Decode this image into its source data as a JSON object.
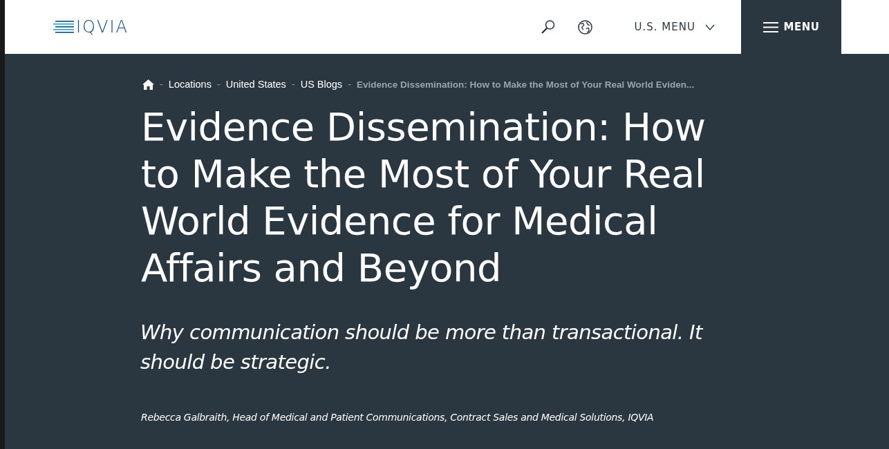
{
  "header": {
    "logo": "IQVIA",
    "region_menu": {
      "label": "U.S. MENU",
      "expanded": false
    },
    "menu_button": "MENU"
  },
  "breadcrumbs": [
    {
      "kind": "home"
    },
    {
      "kind": "link",
      "label": "Locations",
      "separator": "-"
    },
    {
      "kind": "link",
      "label": "United States",
      "separator": "-"
    },
    {
      "kind": "link",
      "label": "US Blogs",
      "separator": "-"
    },
    {
      "kind": "current",
      "label": "Evidence Dissemination: How to Make the Most of Your Real World Eviden...",
      "separator": "-"
    }
  ],
  "article": {
    "title": "Evidence Dissemination: How to Make the Most of Your Real World Evidence for Medical Affairs and Beyond",
    "subtitle": "Why communication should be more than transactional. It should be strategic.",
    "byline": "Rebecca Galbraith, Head of Medical and Patient Communications, Contract Sales and Medical Solutions, IQVIA"
  }
}
